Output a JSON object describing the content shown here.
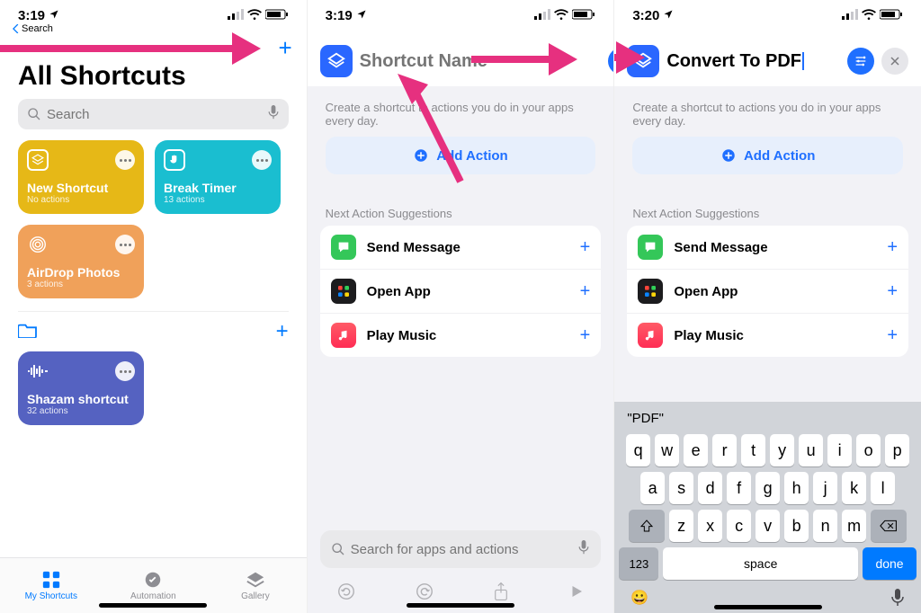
{
  "status": {
    "time1": "3:19",
    "time2": "3:19",
    "time3": "3:20",
    "backlabel": "Search"
  },
  "screen1": {
    "title": "All Shortcuts",
    "search_placeholder": "Search",
    "plus": "+",
    "tiles": [
      {
        "name": "New Shortcut",
        "sub": "No actions"
      },
      {
        "name": "Break Timer",
        "sub": "13 actions"
      },
      {
        "name": "AirDrop Photos",
        "sub": "3 actions"
      },
      {
        "name": "Shazam shortcut",
        "sub": "32 actions"
      }
    ],
    "tabs": {
      "my": "My Shortcuts",
      "auto": "Automation",
      "gallery": "Gallery"
    }
  },
  "editor": {
    "placeholder_title": "Shortcut Name",
    "named_title": "Convert To PDF",
    "hint": "Create a shortcut to actions you do in your apps every day.",
    "add_action": "Add Action",
    "suggestions_label": "Next Action Suggestions",
    "suggestions": [
      {
        "label": "Send Message"
      },
      {
        "label": "Open App"
      },
      {
        "label": "Play Music"
      }
    ],
    "bottom_search_placeholder": "Search for apps and actions"
  },
  "keyboard": {
    "suggestion": "\"PDF\"",
    "row1": [
      "q",
      "w",
      "e",
      "r",
      "t",
      "y",
      "u",
      "i",
      "o",
      "p"
    ],
    "row2": [
      "a",
      "s",
      "d",
      "f",
      "g",
      "h",
      "j",
      "k",
      "l"
    ],
    "row3": [
      "z",
      "x",
      "c",
      "v",
      "b",
      "n",
      "m"
    ],
    "numkey": "123",
    "space": "space",
    "done": "done"
  }
}
